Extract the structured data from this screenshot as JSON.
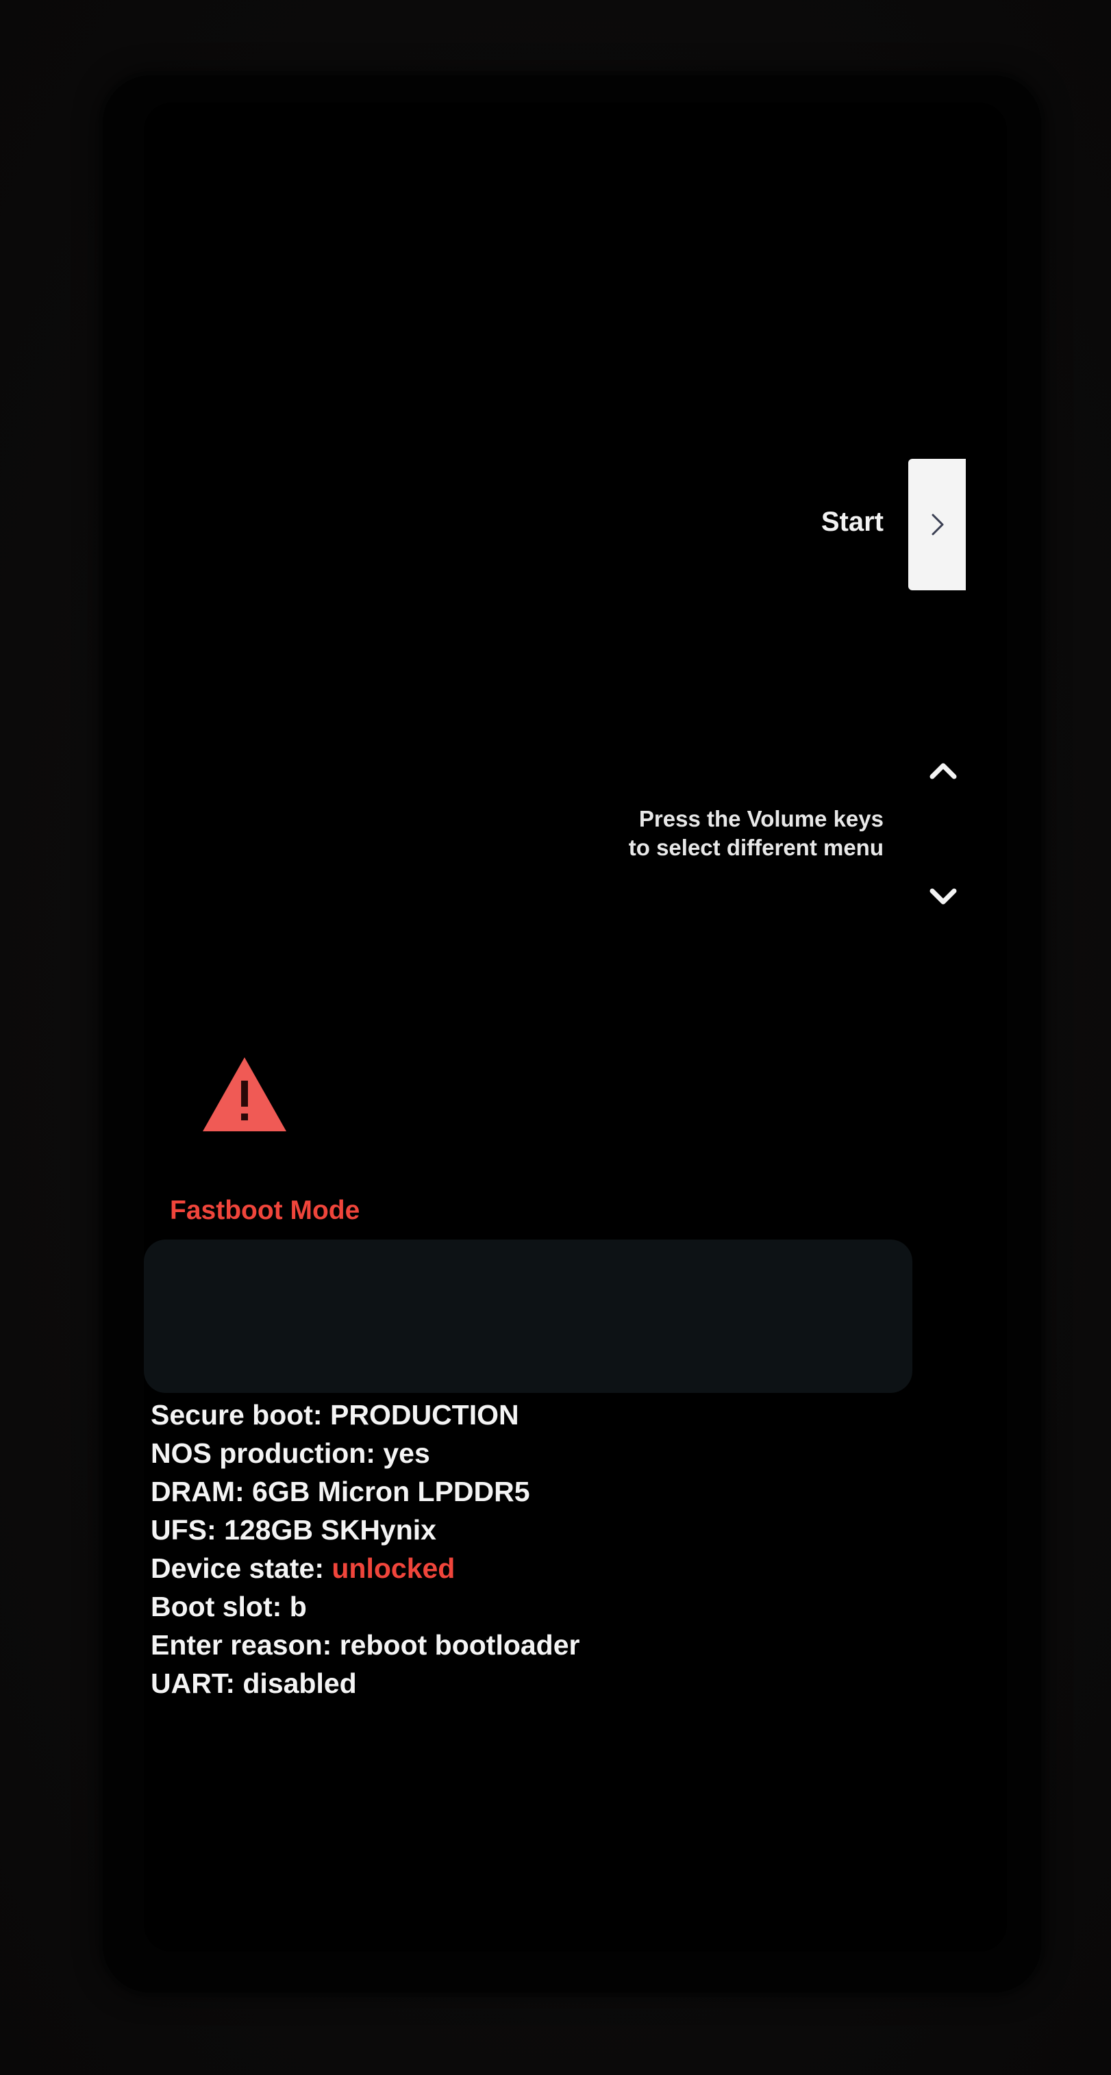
{
  "menu": {
    "start_label": "Start",
    "volume_hint_line1": "Press the Volume keys",
    "volume_hint_line2": "to select different menu"
  },
  "mode": {
    "title": "Fastboot Mode"
  },
  "info": [
    {
      "label": "Secure boot:",
      "value": "PRODUCTION"
    },
    {
      "label": "NOS production:",
      "value": "yes"
    },
    {
      "label": "DRAM:",
      "value": "6GB Micron LPDDR5"
    },
    {
      "label": "UFS:",
      "value": "128GB SKHynix"
    },
    {
      "label": "Device state:",
      "value": "unlocked"
    },
    {
      "label": "Boot slot:",
      "value": "b"
    },
    {
      "label": "Enter reason:",
      "value": "reboot bootloader"
    },
    {
      "label": "UART:",
      "value": "disabled"
    }
  ],
  "colors": {
    "warning_red": "#f0453b",
    "text": "#f4f4f4",
    "background": "#000000",
    "redacted_panel": "#0d1215"
  },
  "icons": {
    "start": "chevron-right-icon",
    "volume_up": "chevron-up-icon",
    "volume_down": "chevron-down-icon",
    "warning": "warning-triangle-icon"
  }
}
